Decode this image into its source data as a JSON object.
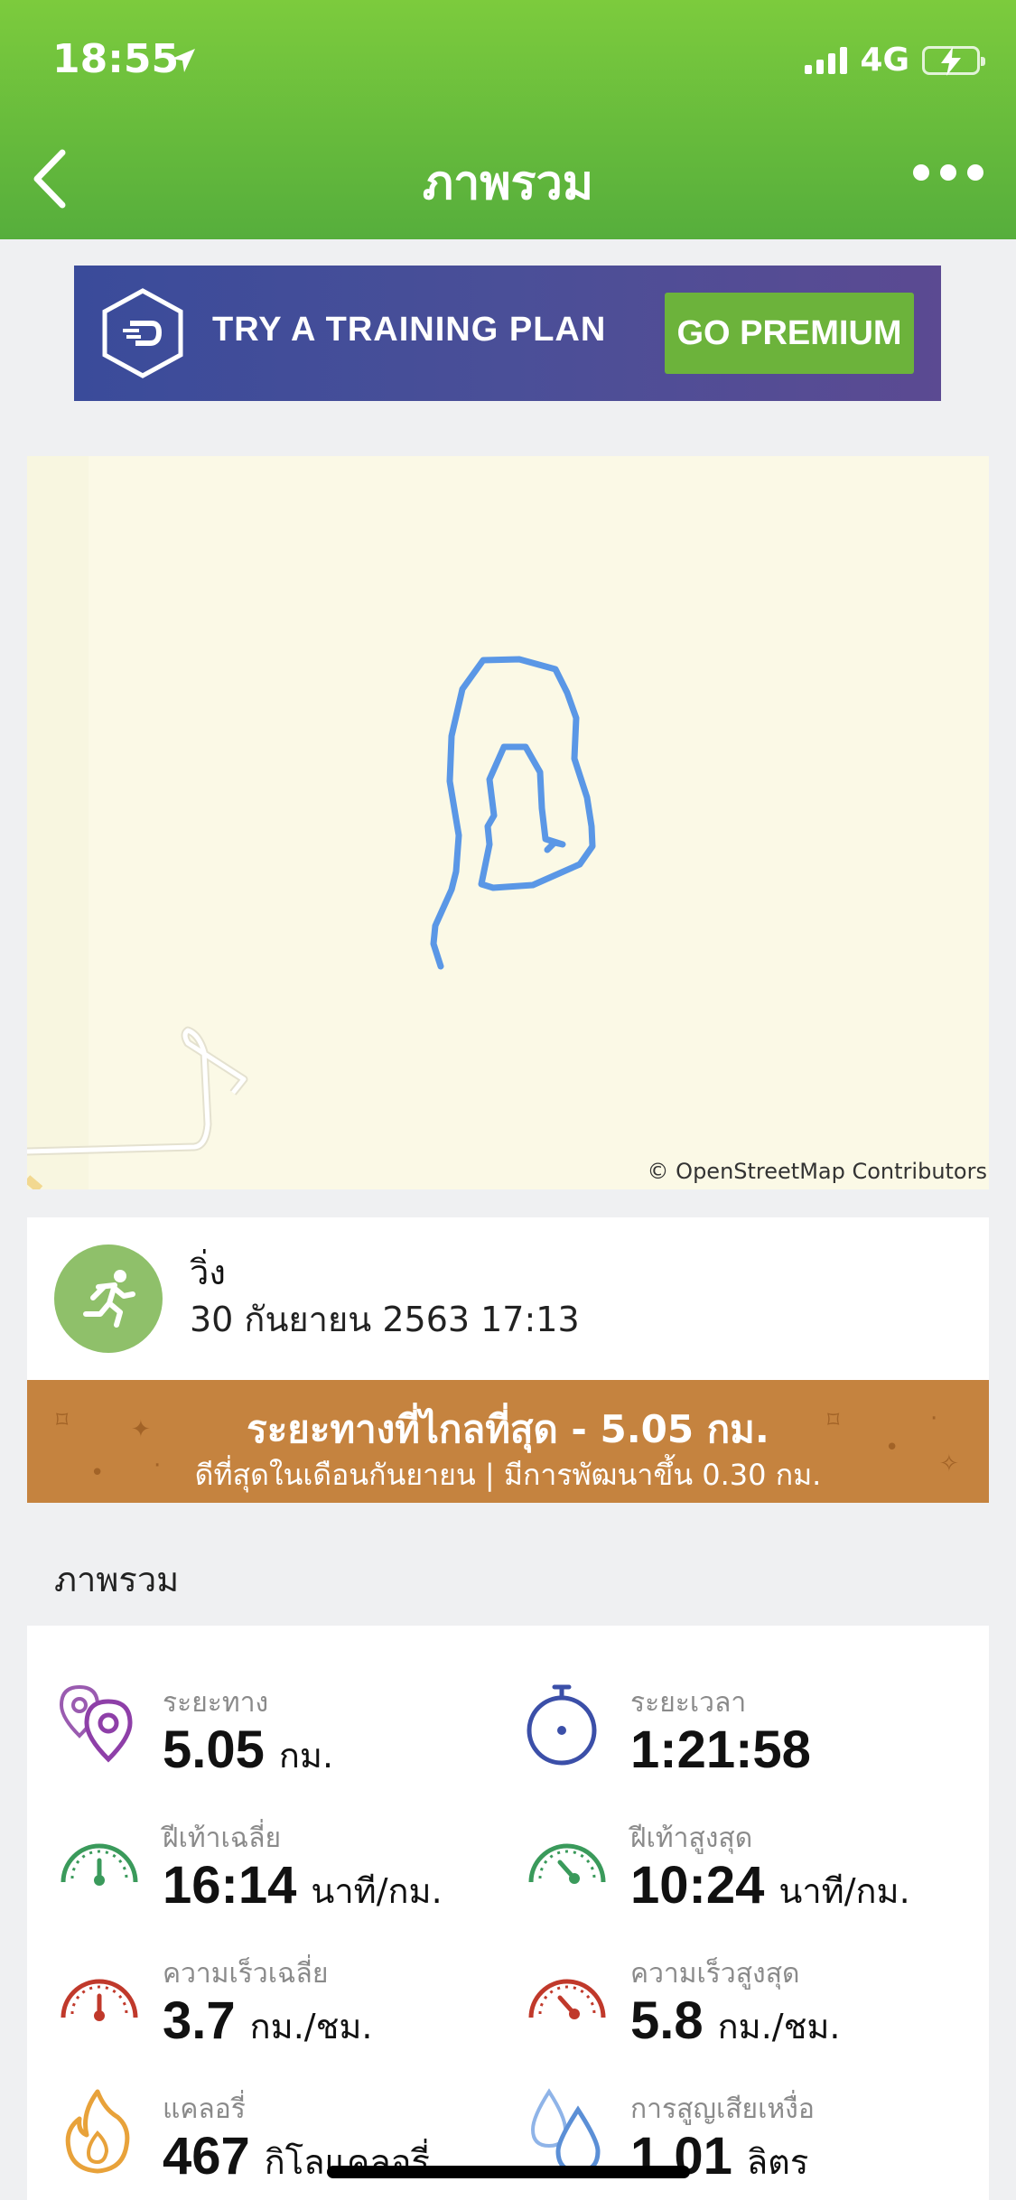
{
  "status_bar": {
    "time": "18:55",
    "network": "4G"
  },
  "nav": {
    "title": "ภาพรวม"
  },
  "ad": {
    "text": "TRY A TRAINING PLAN",
    "button": "GO PREMIUM"
  },
  "map": {
    "credit": "© OpenStreetMap Contributors"
  },
  "activity": {
    "type": "วิ่ง",
    "datetime": "30 กันยายน 2563 17:13"
  },
  "achievement": {
    "title": "ระยะทางที่ไกลที่สุด - 5.05 กม.",
    "subtitle": "ดีที่สุดในเดือนกันยายน | มีการพัฒนาขึ้น 0.30 กม."
  },
  "overview": {
    "title": "ภาพรวม",
    "stats": [
      {
        "label": "ระยะทาง",
        "value": "5.05",
        "unit": "กม.",
        "icon": "distance-pin-icon",
        "color": "#8e44ad"
      },
      {
        "label": "ระยะเวลา",
        "value": "1:21:58",
        "unit": "",
        "icon": "stopwatch-icon",
        "color": "#3b4fa8"
      },
      {
        "label": "ฝีเท้าเฉลี่ย",
        "value": "16:14",
        "unit": "นาที/กม.",
        "icon": "pace-gauge-icon",
        "color": "#3a9a5b"
      },
      {
        "label": "ฝีเท้าสูงสุด",
        "value": "10:24",
        "unit": "นาที/กม.",
        "icon": "max-pace-gauge-icon",
        "color": "#3a9a5b"
      },
      {
        "label": "ความเร็วเฉลี่ย",
        "value": "3.7",
        "unit": "กม./ชม.",
        "icon": "speed-gauge-icon",
        "color": "#c0392b"
      },
      {
        "label": "ความเร็วสูงสุด",
        "value": "5.8",
        "unit": "กม./ชม.",
        "icon": "max-speed-gauge-icon",
        "color": "#c0392b"
      },
      {
        "label": "แคลอรี่",
        "value": "467",
        "unit": "กิโลแคลอรี่",
        "icon": "flame-icon",
        "color": "#e8a23a"
      },
      {
        "label": "การสูญเสียเหงื่อ",
        "value": "1.01",
        "unit": "ลิตร",
        "icon": "water-drops-icon",
        "color": "#5b8fd6"
      }
    ]
  }
}
